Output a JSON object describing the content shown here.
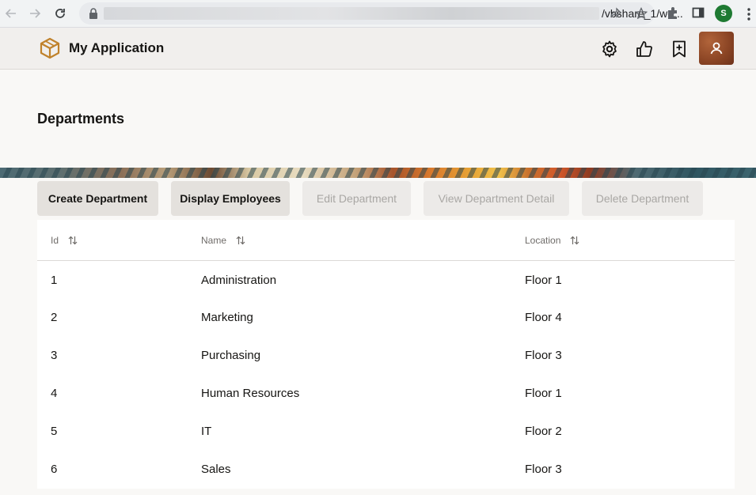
{
  "browser": {
    "url_suffix": "/vbshare_1/we...",
    "profile_initial": "S"
  },
  "app": {
    "title": "My Application"
  },
  "page": {
    "title": "Departments"
  },
  "toolbar": {
    "buttons": [
      {
        "label": "Create Department",
        "enabled": true
      },
      {
        "label": "Display Employees",
        "enabled": true
      },
      {
        "label": "Edit Department",
        "enabled": false
      },
      {
        "label": "View Department Detail",
        "enabled": false
      },
      {
        "label": "Delete Department",
        "enabled": false
      }
    ]
  },
  "table": {
    "columns": [
      "Id",
      "Name",
      "Location"
    ],
    "rows": [
      {
        "id": "1",
        "name": "Administration",
        "location": "Floor 1"
      },
      {
        "id": "2",
        "name": "Marketing",
        "location": "Floor 4"
      },
      {
        "id": "3",
        "name": "Purchasing",
        "location": "Floor 3"
      },
      {
        "id": "4",
        "name": "Human Resources",
        "location": "Floor 1"
      },
      {
        "id": "5",
        "name": "IT",
        "location": "Floor 2"
      },
      {
        "id": "6",
        "name": "Sales",
        "location": "Floor 3"
      }
    ]
  },
  "colors": {
    "logo_accent": "#c0822c",
    "profile_bg": "#1e7a32",
    "avatar_bg": "#8a4424"
  }
}
